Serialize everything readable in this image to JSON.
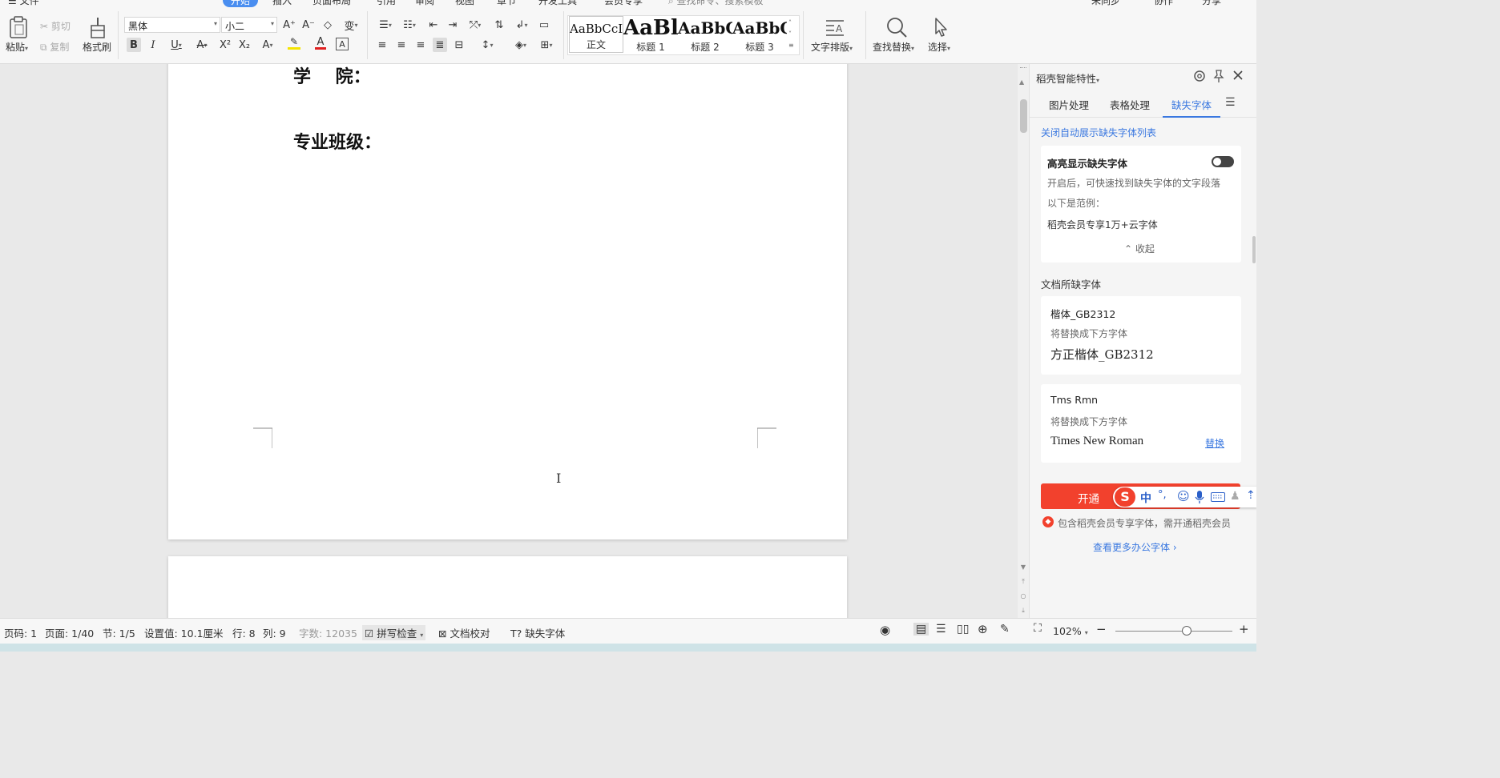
{
  "menu": {
    "file": "文件",
    "tabs": [
      "开始",
      "插入",
      "页面布局",
      "引用",
      "审阅",
      "视图",
      "章节",
      "开发工具",
      "会员专享"
    ],
    "search": "查找命令、搜索模板",
    "right": [
      "未同步",
      "协作",
      "分享"
    ]
  },
  "ribbon": {
    "paste": "粘贴",
    "cut": "剪切",
    "copy": "复制",
    "format_painter": "格式刷",
    "font_name": "黑体",
    "font_size": "小二",
    "styles": [
      {
        "sample": "AaBbCcI",
        "name": "正文"
      },
      {
        "sample": "AaBl",
        "name": "标题 1"
      },
      {
        "sample": "AaBbC",
        "name": "标题 2"
      },
      {
        "sample": "AaBbC",
        "name": "标题 3"
      }
    ],
    "text_layout": "文字排版",
    "find_replace": "查找替换",
    "select": "选择"
  },
  "document": {
    "line1": "学    院：",
    "line2": "专业班级："
  },
  "side_panel": {
    "title": "稻壳智能特性",
    "tabs": [
      "图片处理",
      "表格处理",
      "缺失字体"
    ],
    "active_tab": 2,
    "close_auto": "关闭自动展示缺失字体列表",
    "highlight_title": "高亮显示缺失字体",
    "highlight_on": false,
    "highlight_desc": "开启后，可快速找到缺失字体的文字段落",
    "example_label": "以下是范例：",
    "example_text": "稻壳会员专享1万+云字体",
    "collapse": "收起",
    "missing_header": "文档所缺字体",
    "fonts": [
      {
        "name": "楷体_GB2312",
        "hint": "将替换成下方字体",
        "replacement": "方正楷体_GB2312",
        "action": ""
      },
      {
        "name": "Tms Rmn",
        "hint": "将替换成下方字体",
        "replacement": "Times New Roman",
        "action": "替换"
      }
    ],
    "open_button": "开通",
    "ime": [
      "中",
      "°,"
    ],
    "member_note": "包含稻壳会员专享字体，需开通稻壳会员",
    "more_link": "查看更多办公字体"
  },
  "status": {
    "page_code": "页码: 1",
    "page": "页面: 1/40",
    "section": "节: 1/5",
    "setting": "设置值: 10.1厘米",
    "row": "行: 8",
    "col": "列: 9",
    "word_count": "字数: 12035",
    "spell_check": "拼写检查",
    "proofread": "文档校对",
    "missing_font": "缺失字体",
    "zoom": "102%",
    "zoom_level": 0.61
  },
  "colors": {
    "accent": "#3a78e0",
    "open_button": "#f2412d",
    "highlight_bar": "#f5e400",
    "font_color_bar": "#e02020"
  }
}
